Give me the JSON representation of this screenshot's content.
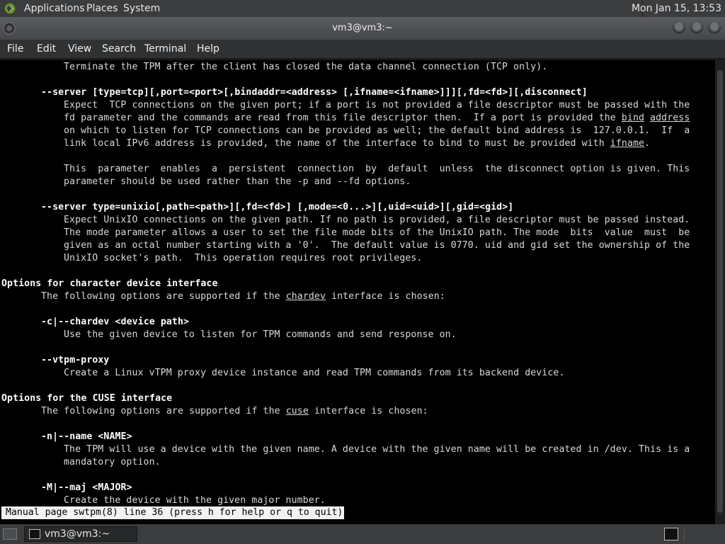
{
  "top_panel": {
    "menus": [
      "Applications",
      "Places",
      "System"
    ],
    "clock": "Mon Jan 15, 13:53"
  },
  "window": {
    "title": "vm3@vm3:~"
  },
  "menubar": [
    "File",
    "Edit",
    "View",
    "Search",
    "Terminal",
    "Help"
  ],
  "terminal": {
    "lines": [
      {
        "i": 11,
        "seg": [
          [
            "Terminate the TPM after the client has closed the data channel connection (TCP only).",
            ""
          ]
        ]
      },
      {
        "i": 0,
        "seg": [
          [
            "",
            ""
          ]
        ]
      },
      {
        "i": 7,
        "seg": [
          [
            "--server [type=tcp][,port=<port>[,bindaddr=<address> [,ifname=<ifname>]]][,fd=<fd>][,disconnect]",
            "b"
          ]
        ]
      },
      {
        "i": 11,
        "seg": [
          [
            "Expect  TCP connections on the given port; if a port is not provided a file descriptor must be passed with the",
            ""
          ]
        ]
      },
      {
        "i": 11,
        "seg": [
          [
            "fd parameter and the commands are read from this file descriptor then.  If a port is provided the ",
            ""
          ],
          [
            "bind",
            "u"
          ],
          [
            " ",
            ""
          ],
          [
            "address",
            "u"
          ]
        ]
      },
      {
        "i": 11,
        "seg": [
          [
            "on which to listen for TCP connections can be provided as well; the default bind address is  127.0.0.1.  If  a",
            ""
          ]
        ]
      },
      {
        "i": 11,
        "seg": [
          [
            "link local IPv6 address is provided, the name of the interface to bind to must be provided with ",
            ""
          ],
          [
            "ifname",
            "u"
          ],
          [
            ".",
            ""
          ]
        ]
      },
      {
        "i": 0,
        "seg": [
          [
            "",
            ""
          ]
        ]
      },
      {
        "i": 11,
        "seg": [
          [
            "This  parameter  enables  a  persistent  connection  by  default  unless  the disconnect option is given. This",
            ""
          ]
        ]
      },
      {
        "i": 11,
        "seg": [
          [
            "parameter should be used rather than the -p and --fd options.",
            ""
          ]
        ]
      },
      {
        "i": 0,
        "seg": [
          [
            "",
            ""
          ]
        ]
      },
      {
        "i": 7,
        "seg": [
          [
            "--server type=unixio[,path=<path>][,fd=<fd>] [,mode=<0...>][,uid=<uid>][,gid=<gid>]",
            "b"
          ]
        ]
      },
      {
        "i": 11,
        "seg": [
          [
            "Expect UnixIO connections on the given path. If no path is provided, a file descriptor must be passed instead.",
            ""
          ]
        ]
      },
      {
        "i": 11,
        "seg": [
          [
            "The mode parameter allows a user to set the file mode bits of the UnixIO path. The mode  bits  value  must  be",
            ""
          ]
        ]
      },
      {
        "i": 11,
        "seg": [
          [
            "given as an octal number starting with a '0'.  The default value is 0770. uid and gid set the ownership of the",
            ""
          ]
        ]
      },
      {
        "i": 11,
        "seg": [
          [
            "UnixIO socket's path.  This operation requires root privileges.",
            ""
          ]
        ]
      },
      {
        "i": 0,
        "seg": [
          [
            "",
            ""
          ]
        ]
      },
      {
        "i": 0,
        "seg": [
          [
            "Options for character device interface",
            "b"
          ]
        ]
      },
      {
        "i": 7,
        "seg": [
          [
            "The following options are supported if the ",
            ""
          ],
          [
            "chardev",
            "u"
          ],
          [
            " interface is chosen:",
            ""
          ]
        ]
      },
      {
        "i": 0,
        "seg": [
          [
            "",
            ""
          ]
        ]
      },
      {
        "i": 7,
        "seg": [
          [
            "-c|--chardev <device path>",
            "b"
          ]
        ]
      },
      {
        "i": 11,
        "seg": [
          [
            "Use the given device to listen for TPM commands and send response on.",
            ""
          ]
        ]
      },
      {
        "i": 0,
        "seg": [
          [
            "",
            ""
          ]
        ]
      },
      {
        "i": 7,
        "seg": [
          [
            "--vtpm-proxy",
            "b"
          ]
        ]
      },
      {
        "i": 11,
        "seg": [
          [
            "Create a Linux vTPM proxy device instance and read TPM commands from its backend device.",
            ""
          ]
        ]
      },
      {
        "i": 0,
        "seg": [
          [
            "",
            ""
          ]
        ]
      },
      {
        "i": 0,
        "seg": [
          [
            "Options for the CUSE interface",
            "b"
          ]
        ]
      },
      {
        "i": 7,
        "seg": [
          [
            "The following options are supported if the ",
            ""
          ],
          [
            "cuse",
            "u"
          ],
          [
            " interface is chosen:",
            ""
          ]
        ]
      },
      {
        "i": 0,
        "seg": [
          [
            "",
            ""
          ]
        ]
      },
      {
        "i": 7,
        "seg": [
          [
            "-n|--name <NAME>",
            "b"
          ]
        ]
      },
      {
        "i": 11,
        "seg": [
          [
            "The TPM will use a device with the given name. A device with the given name will be created in /dev. This is a",
            ""
          ]
        ]
      },
      {
        "i": 11,
        "seg": [
          [
            "mandatory option.",
            ""
          ]
        ]
      },
      {
        "i": 0,
        "seg": [
          [
            "",
            ""
          ]
        ]
      },
      {
        "i": 7,
        "seg": [
          [
            "-M|--maj <MAJOR>",
            "b"
          ]
        ]
      },
      {
        "i": 11,
        "seg": [
          [
            "Create the device with the given major number.",
            ""
          ]
        ]
      }
    ],
    "status": "Manual page swtpm(8) line 36 (press h for help or q to quit)"
  },
  "taskbar": {
    "task_label": "vm3@vm3:~"
  }
}
